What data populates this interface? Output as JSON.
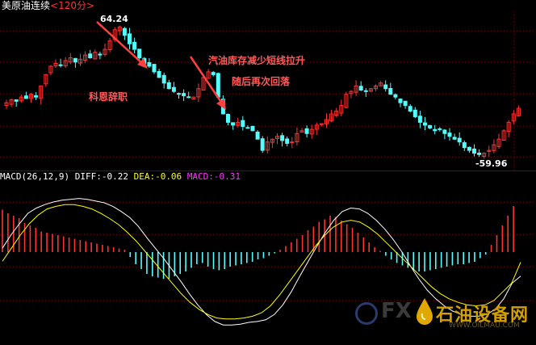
{
  "header": {
    "title": "美原油连续",
    "period": "<120分>"
  },
  "price_panel": {
    "high_label": "64.24",
    "low_label": "-59.96",
    "annotations": {
      "kohen": "科恩辞职",
      "inventory_line1": "汽油库存减少短线拉升",
      "inventory_line2": "随后再次回落"
    }
  },
  "macd_panel": {
    "name": "MACD(26,12,9)",
    "diff_label": "DIFF:-0.22",
    "dea_label": "DEA:-0.06",
    "macd_label": "MACD:-0.31"
  },
  "watermark": {
    "brand_latin": "FX",
    "brand_cn": "石油设备网",
    "url": "WWW.OILMAU.COM"
  },
  "colors": {
    "up": "#ff3232",
    "down": "#54fcfc",
    "diff": "#ffffff",
    "dea": "#ffff00",
    "grid": "#8b0000",
    "annotation": "#ff5a5a",
    "arrow": "#ff4040"
  },
  "chart_data": {
    "type": "candlestick-macd",
    "price_extremes": {
      "high": 64.24,
      "low": 59.96
    },
    "macd": {
      "params": [
        26,
        12,
        9
      ],
      "diff": -0.22,
      "dea": -0.06,
      "macd": -0.31
    },
    "close_profile": [
      61.3,
      61.4,
      61.35,
      61.5,
      61.45,
      61.6,
      61.5,
      61.9,
      62.3,
      62.6,
      62.7,
      62.65,
      62.8,
      62.9,
      62.75,
      62.85,
      63.0,
      62.9,
      63.1,
      63.0,
      63.2,
      63.5,
      63.9,
      64.0,
      63.7,
      63.4,
      63.2,
      62.9,
      62.7,
      62.6,
      62.4,
      62.2,
      62.0,
      61.8,
      61.7,
      61.6,
      61.55,
      61.5,
      61.5,
      61.8,
      62.2,
      62.4,
      62.3,
      61.5,
      60.9,
      60.6,
      60.5,
      60.6,
      60.45,
      60.4,
      60.3,
      60.0,
      59.6,
      59.9,
      60.0,
      60.1,
      59.95,
      59.85,
      59.9,
      60.2,
      60.3,
      60.2,
      60.35,
      60.5,
      60.55,
      60.7,
      60.9,
      61.0,
      61.2,
      61.6,
      61.7,
      61.9,
      61.75,
      61.7,
      61.8,
      61.9,
      62.0,
      61.8,
      61.6,
      61.5,
      61.3,
      61.2,
      61.0,
      60.8,
      60.6,
      60.5,
      60.4,
      60.3,
      60.35,
      60.2,
      60.1,
      60.0,
      59.9,
      59.7,
      59.6,
      59.5,
      59.45,
      59.5,
      59.6,
      59.8,
      60.0,
      60.3,
      60.6,
      60.9,
      61.1
    ],
    "macd_histogram_profile": [
      0.35,
      0.32,
      0.3,
      0.28,
      0.24,
      0.22,
      0.2,
      0.17,
      0.16,
      0.15,
      0.14,
      0.13,
      0.12,
      0.11,
      0.1,
      0.09,
      0.08,
      0.07,
      0.06,
      0.05,
      0.04,
      0.03,
      0.02,
      -0.04,
      -0.1,
      -0.14,
      -0.18,
      -0.2,
      -0.21,
      -0.22,
      -0.22,
      -0.2,
      -0.18,
      -0.16,
      -0.13,
      -0.1,
      -0.09,
      -0.12,
      -0.14,
      -0.15,
      -0.14,
      -0.12,
      -0.11,
      -0.1,
      -0.09,
      -0.08,
      -0.06,
      -0.05,
      -0.03,
      -0.01,
      0.02,
      0.05,
      0.08,
      0.11,
      0.14,
      0.18,
      0.21,
      0.25,
      0.27,
      0.3,
      0.29,
      0.26,
      0.23,
      0.2,
      0.16,
      0.12,
      0.08,
      0.04,
      0.01,
      -0.03,
      -0.06,
      -0.09,
      -0.11,
      -0.13,
      -0.15,
      -0.16,
      -0.16,
      -0.15,
      -0.14,
      -0.13,
      -0.12,
      -0.11,
      -0.1,
      -0.1,
      -0.09,
      -0.08,
      -0.05,
      -0.02,
      0.06,
      0.14,
      0.22,
      0.3,
      0.38
    ],
    "diff_profile": [
      0.1,
      0.25,
      0.38,
      0.5,
      0.56,
      0.6,
      0.63,
      0.65,
      0.66,
      0.67,
      0.66,
      0.64,
      0.62,
      0.58,
      0.52,
      0.45,
      0.35,
      0.22,
      0.1,
      -0.02,
      -0.15,
      -0.28,
      -0.42,
      -0.55,
      -0.66,
      -0.74,
      -0.78,
      -0.78,
      -0.77,
      -0.75,
      -0.74,
      -0.72,
      -0.66,
      -0.55,
      -0.4,
      -0.22,
      -0.05,
      0.12,
      0.28,
      0.42,
      0.52,
      0.56,
      0.55,
      0.5,
      0.42,
      0.32,
      0.2,
      0.06,
      -0.1,
      -0.25,
      -0.38,
      -0.48,
      -0.56,
      -0.62,
      -0.66,
      -0.68,
      -0.68,
      -0.66,
      -0.6,
      -0.48,
      -0.3,
      -0.22
    ],
    "dea_profile": [
      -0.05,
      0.1,
      0.25,
      0.38,
      0.48,
      0.55,
      0.58,
      0.6,
      0.6,
      0.58,
      0.55,
      0.5,
      0.44,
      0.37,
      0.28,
      0.18,
      0.06,
      -0.06,
      -0.18,
      -0.3,
      -0.42,
      -0.52,
      -0.6,
      -0.66,
      -0.7,
      -0.71,
      -0.71,
      -0.7,
      -0.68,
      -0.64,
      -0.56,
      -0.44,
      -0.3,
      -0.16,
      -0.02,
      0.12,
      0.24,
      0.34,
      0.4,
      0.42,
      0.4,
      0.34,
      0.26,
      0.16,
      0.06,
      -0.04,
      -0.14,
      -0.24,
      -0.34,
      -0.42,
      -0.48,
      -0.52,
      -0.55,
      -0.56,
      -0.55,
      -0.5,
      -0.4,
      -0.3,
      -0.06
    ]
  }
}
